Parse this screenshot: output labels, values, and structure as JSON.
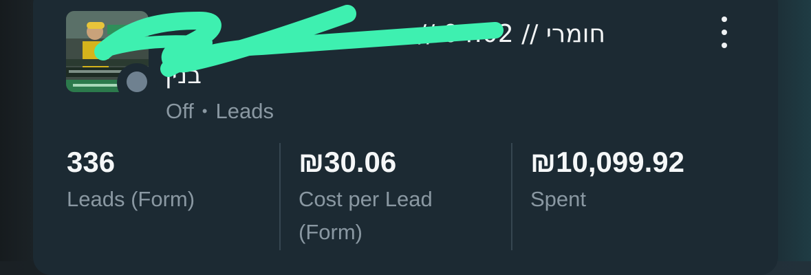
{
  "campaign": {
    "title": "חומרי // 04.02 // ...",
    "title_line2": "בנין",
    "status": "Off",
    "separator": "•",
    "objective": "Leads"
  },
  "metrics": [
    {
      "value": "336",
      "label": "Leads (Form)"
    },
    {
      "value": "₪30.06",
      "label": "Cost per Lead (Form)"
    },
    {
      "value": "₪10,099.92",
      "label": "Spent"
    }
  ],
  "colors": {
    "card_bg": "#1c2a33",
    "status_dot_off": "#6f8190",
    "redaction_scribble": "#3ef0b0"
  },
  "icons": {
    "menu": "more-vertical-icon",
    "status": "status-dot-icon"
  }
}
